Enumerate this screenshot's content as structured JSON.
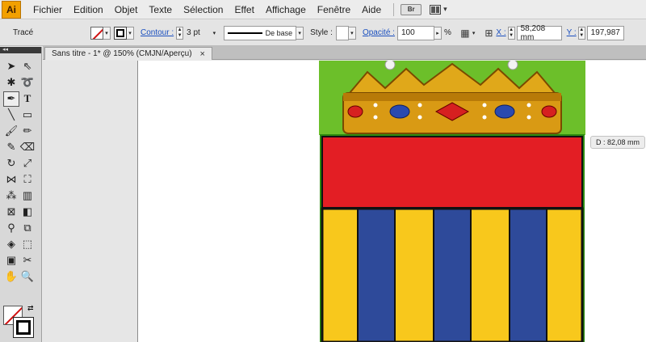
{
  "app": {
    "logo_text": "Ai"
  },
  "menu": {
    "items": [
      "Fichier",
      "Edition",
      "Objet",
      "Texte",
      "Sélection",
      "Effet",
      "Affichage",
      "Fenêtre",
      "Aide"
    ],
    "bridge_label": "Br"
  },
  "control": {
    "selection_label": "Tracé",
    "stroke_label": "Contour :",
    "stroke_weight": "3 pt",
    "profile_label": "De base",
    "style_label": "Style :",
    "opacity_label": "Opacité :",
    "opacity_value": "100",
    "opacity_unit": "%",
    "x_label": "X :",
    "x_value": "58,208 mm",
    "y_label": "Y :",
    "y_value": "197,987"
  },
  "document": {
    "tab_title": "Sans titre - 1* @ 150% (CMJN/Aperçu)",
    "close_glyph": "×"
  },
  "tooltip": {
    "dimension": "D : 82,08 mm"
  },
  "colors": {
    "crown_gold": "#e0a81a",
    "green": "#6cbf2a",
    "red": "#e31e24",
    "yellow": "#f8c81c",
    "blue": "#2e4a9a"
  }
}
